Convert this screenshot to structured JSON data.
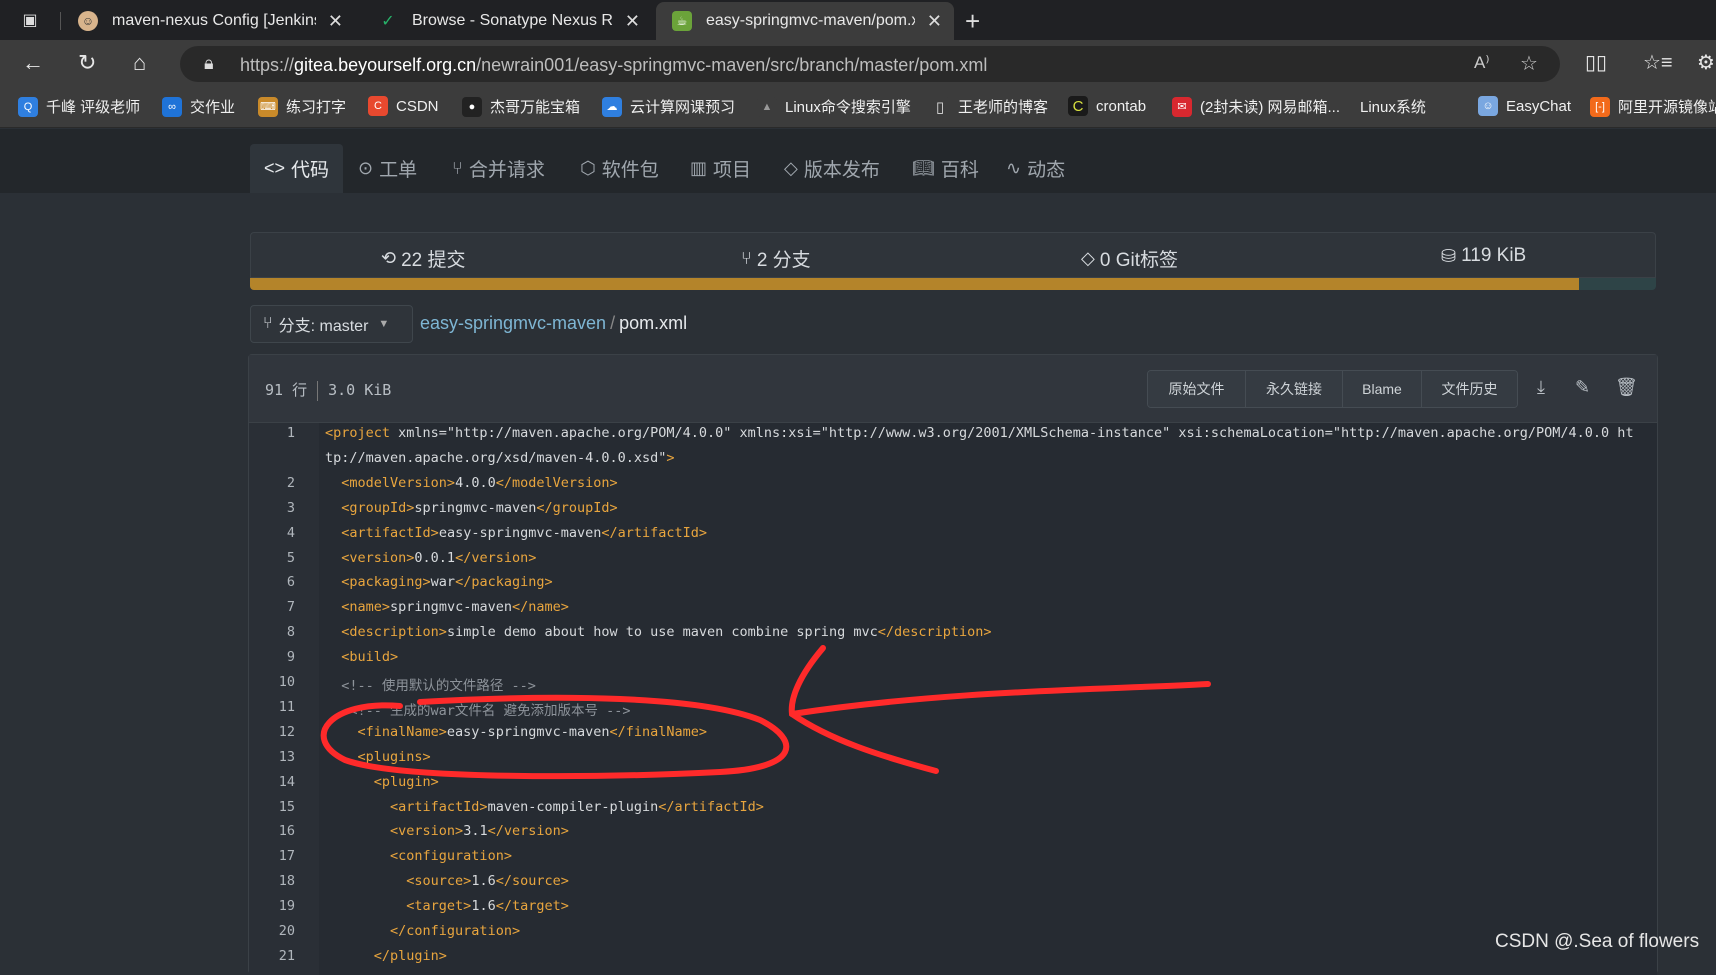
{
  "browser": {
    "tabs": [
      {
        "title": "maven-nexus Config [Jenkins]",
        "active": false
      },
      {
        "title": "Browse - Sonatype Nexus Reposi",
        "active": false
      },
      {
        "title": "easy-springmvc-maven/pom.xml",
        "active": true
      }
    ],
    "url_prefix": "https://",
    "url_host": "gitea.beyourself.org.cn",
    "url_path": "/newrain001/easy-springmvc-maven/src/branch/master/pom.xml",
    "bookmarks": [
      {
        "label": "千峰 评级老师",
        "icon": "q-icon",
        "color": "#2f7fe0"
      },
      {
        "label": "交作业",
        "icon": "ooo-icon",
        "color": "#1f73d8"
      },
      {
        "label": "练习打字",
        "icon": "keyboard-icon",
        "color": "#c98a2a"
      },
      {
        "label": "CSDN",
        "icon": "csdn-icon",
        "color": "#e8492f"
      },
      {
        "label": "杰哥万能宝箱",
        "icon": "bear-icon",
        "color": "#333333"
      },
      {
        "label": "云计算网课预习",
        "icon": "cloud-icon",
        "color": "#2f7fe0"
      },
      {
        "label": "Linux命令搜索引擎",
        "icon": "penguin-icon",
        "color": "#555555"
      },
      {
        "label": "王老师的博客",
        "icon": "page-icon",
        "color": "#666666"
      },
      {
        "label": "crontab",
        "icon": "c-icon",
        "color": "#b5c52a"
      },
      {
        "label": "(2封未读) 网易邮箱...",
        "icon": "mail-icon",
        "color": "#d8282f"
      },
      {
        "label": "Linux系统",
        "icon": "blank-icon",
        "color": "#3c3c3c"
      },
      {
        "label": "EasyChat",
        "icon": "chat-icon",
        "color": "#7aa7e0"
      },
      {
        "label": "阿里开源镜像站",
        "icon": "aliyun-icon",
        "color": "#f26a1b"
      }
    ]
  },
  "repo": {
    "tabs": [
      {
        "label": "代码",
        "icon": "code-icon",
        "active": true
      },
      {
        "label": "工单",
        "icon": "issue-icon",
        "active": false
      },
      {
        "label": "合并请求",
        "icon": "pull-request-icon",
        "active": false
      },
      {
        "label": "软件包",
        "icon": "package-icon",
        "active": false
      },
      {
        "label": "项目",
        "icon": "project-icon",
        "active": false
      },
      {
        "label": "版本发布",
        "icon": "tag-icon",
        "active": false
      },
      {
        "label": "百科",
        "icon": "book-icon",
        "active": false
      },
      {
        "label": "动态",
        "icon": "pulse-icon",
        "active": false
      }
    ],
    "stats": {
      "commits": "22 提交",
      "branches": "2 分支",
      "tags": "0 Git标签",
      "size": "119 KiB"
    },
    "language_share": 0.945,
    "language_color": "#b4842a",
    "branch_label": "分支: master",
    "breadcrumb": {
      "repo": "easy-springmvc-maven",
      "separator": "/",
      "file": "pom.xml"
    }
  },
  "file": {
    "lines_count": "91 行",
    "size": "3.0 KiB",
    "buttons": [
      "原始文件",
      "永久链接",
      "Blame",
      "文件历史"
    ],
    "code": [
      {
        "n": "1",
        "segments": [
          [
            "tag",
            "<project"
          ],
          [
            "txt",
            " xmlns=\"http://maven.apache.org/POM/4.0.0\" xmlns:xsi=\"http://www.w3.org/2001/XMLSchema-instance\" xsi:schemaLocation=\"http://maven.apache.org/POM/4.0.0 ht"
          ]
        ]
      },
      {
        "n": "",
        "segments": [
          [
            "txt",
            "tp://maven.apache.org/xsd/maven-4.0.0.xsd\""
          ],
          [
            "tag",
            ">"
          ]
        ]
      },
      {
        "n": "2",
        "segments": [
          [
            "txt",
            "  "
          ],
          [
            "tag",
            "<modelVersion>"
          ],
          [
            "txt",
            "4.0.0"
          ],
          [
            "tag",
            "</modelVersion>"
          ]
        ]
      },
      {
        "n": "3",
        "segments": [
          [
            "txt",
            "  "
          ],
          [
            "tag",
            "<groupId>"
          ],
          [
            "txt",
            "springmvc-maven"
          ],
          [
            "tag",
            "</groupId>"
          ]
        ]
      },
      {
        "n": "4",
        "segments": [
          [
            "txt",
            "  "
          ],
          [
            "tag",
            "<artifactId>"
          ],
          [
            "txt",
            "easy-springmvc-maven"
          ],
          [
            "tag",
            "</artifactId>"
          ]
        ]
      },
      {
        "n": "5",
        "segments": [
          [
            "txt",
            "  "
          ],
          [
            "tag",
            "<version>"
          ],
          [
            "txt",
            "0.0.1"
          ],
          [
            "tag",
            "</version>"
          ]
        ]
      },
      {
        "n": "6",
        "segments": [
          [
            "txt",
            "  "
          ],
          [
            "tag",
            "<packaging>"
          ],
          [
            "txt",
            "war"
          ],
          [
            "tag",
            "</packaging>"
          ]
        ]
      },
      {
        "n": "7",
        "segments": [
          [
            "txt",
            "  "
          ],
          [
            "tag",
            "<name>"
          ],
          [
            "txt",
            "springmvc-maven"
          ],
          [
            "tag",
            "</name>"
          ]
        ]
      },
      {
        "n": "8",
        "segments": [
          [
            "txt",
            "  "
          ],
          [
            "tag",
            "<description>"
          ],
          [
            "txt",
            "simple demo about how to use maven combine spring mvc"
          ],
          [
            "tag",
            "</description>"
          ]
        ]
      },
      {
        "n": "9",
        "segments": [
          [
            "txt",
            "  "
          ],
          [
            "tag",
            "<build>"
          ]
        ]
      },
      {
        "n": "10",
        "segments": [
          [
            "cmt",
            "  <!-- 使用默认的文件路径 -->"
          ]
        ]
      },
      {
        "n": "11",
        "segments": [
          [
            "cmt",
            "   <!-- 生成的war文件名 避免添加版本号 -->"
          ]
        ]
      },
      {
        "n": "12",
        "segments": [
          [
            "txt",
            "    "
          ],
          [
            "tag",
            "<finalName>"
          ],
          [
            "txt",
            "easy-springmvc-maven"
          ],
          [
            "tag",
            "</finalName>"
          ]
        ]
      },
      {
        "n": "13",
        "segments": [
          [
            "txt",
            "    "
          ],
          [
            "tag",
            "<plugins>"
          ]
        ]
      },
      {
        "n": "14",
        "segments": [
          [
            "txt",
            "      "
          ],
          [
            "tag",
            "<plugin>"
          ]
        ]
      },
      {
        "n": "15",
        "segments": [
          [
            "txt",
            "        "
          ],
          [
            "tag",
            "<artifactId>"
          ],
          [
            "txt",
            "maven-compiler-plugin"
          ],
          [
            "tag",
            "</artifactId>"
          ]
        ]
      },
      {
        "n": "16",
        "segments": [
          [
            "txt",
            "        "
          ],
          [
            "tag",
            "<version>"
          ],
          [
            "txt",
            "3.1"
          ],
          [
            "tag",
            "</version>"
          ]
        ]
      },
      {
        "n": "17",
        "segments": [
          [
            "txt",
            "        "
          ],
          [
            "tag",
            "<configuration>"
          ]
        ]
      },
      {
        "n": "18",
        "segments": [
          [
            "txt",
            "          "
          ],
          [
            "tag",
            "<source>"
          ],
          [
            "txt",
            "1.6"
          ],
          [
            "tag",
            "</source>"
          ]
        ]
      },
      {
        "n": "19",
        "segments": [
          [
            "txt",
            "          "
          ],
          [
            "tag",
            "<target>"
          ],
          [
            "txt",
            "1.6"
          ],
          [
            "tag",
            "</target>"
          ]
        ]
      },
      {
        "n": "20",
        "segments": [
          [
            "txt",
            "        "
          ],
          [
            "tag",
            "</configuration>"
          ]
        ]
      },
      {
        "n": "21",
        "segments": [
          [
            "txt",
            "      "
          ],
          [
            "tag",
            "</plugin>"
          ]
        ]
      }
    ]
  },
  "annotation_color": "#ff2a2a",
  "watermark": "CSDN @.Sea of flowers"
}
